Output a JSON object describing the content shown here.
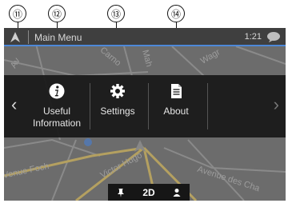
{
  "callouts": [
    "⑪",
    "⑫",
    "⑬",
    "⑭"
  ],
  "status_bar": {
    "title": "Main Menu",
    "clock": "1:21"
  },
  "menu": {
    "items": [
      {
        "label_line1": "Useful",
        "label_line2": "Information",
        "icon": "info-icon"
      },
      {
        "label": "Settings",
        "icon": "gear-icon"
      },
      {
        "label": "About",
        "icon": "document-icon"
      }
    ],
    "prev_arrow": "‹",
    "next_arrow": "›"
  },
  "map": {
    "street_labels": [
      "Venue Foch",
      "Victor Hugo",
      "Avenue des Cha",
      "Mah",
      "Wagr",
      "Carno",
      "Av"
    ]
  },
  "map_controls": {
    "view_mode": "2D"
  },
  "colors": {
    "status_accent": "#4d88d8",
    "menu_bg": "#1a1a1a",
    "map_bg": "#6c6c6c"
  }
}
